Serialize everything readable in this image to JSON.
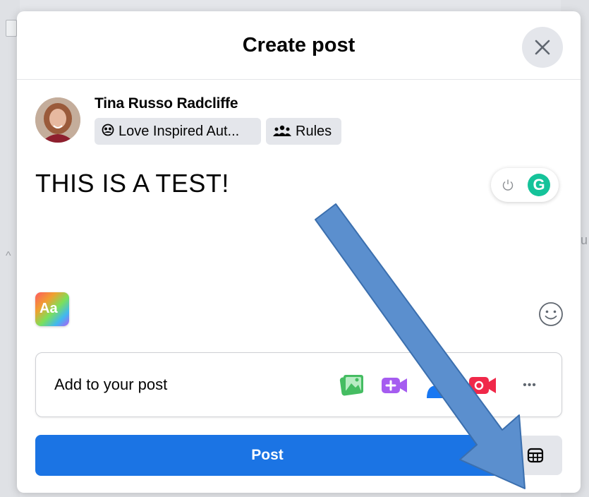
{
  "dialog": {
    "title": "Create post"
  },
  "user": {
    "name": "Tina Russo Radcliffe"
  },
  "audience": {
    "group_label": "Love Inspired Aut...",
    "rules_label": "Rules"
  },
  "composer": {
    "text": "THIS IS A TEST!"
  },
  "add_to_post": {
    "label": "Add to your post",
    "more_label": "•••",
    "icons": [
      "photo-video-icon",
      "video-add-icon",
      "tag-people-icon",
      "live-video-icon",
      "more-icon"
    ]
  },
  "actions": {
    "post_label": "Post"
  },
  "icons": {
    "close": "close-icon",
    "group": "group-icon",
    "rules": "people-icon",
    "grammarly_power": "power-icon",
    "grammarly_logo": "G",
    "text_style": "Aa",
    "emoji": "smiley-icon",
    "schedule": "calendar-icon"
  },
  "colors": {
    "primary": "#1b74e4",
    "photo": "#45bd62",
    "video": "#a55cf0",
    "tag": "#1877f2",
    "live": "#f02849",
    "grammarly": "#15c39a",
    "annotation_arrow": "#5b8fce"
  }
}
